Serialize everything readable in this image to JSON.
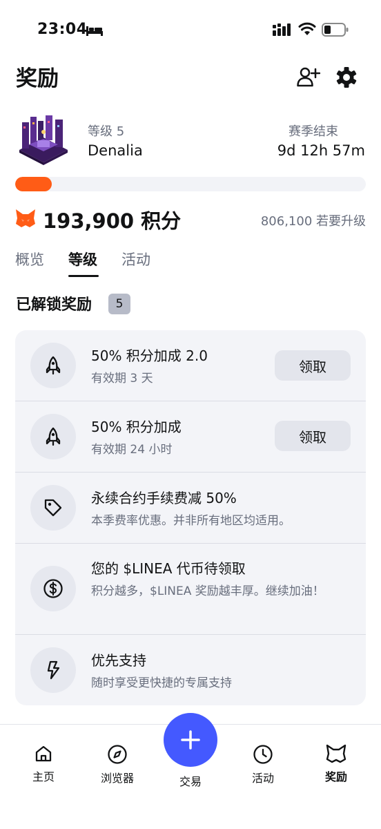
{
  "status_bar": {
    "time": "23:04"
  },
  "header": {
    "title": "奖励"
  },
  "season": {
    "level_label": "等级 5",
    "name": "Denalia",
    "end_label": "赛季结束",
    "countdown": "9d 12h 57m",
    "progress_fraction": 0.105
  },
  "points": {
    "value": "193,900 积分",
    "to_next_level": "806,100 若要升级"
  },
  "tabs": [
    {
      "label": "概览",
      "active": false
    },
    {
      "label": "等级",
      "active": true
    },
    {
      "label": "活动",
      "active": false
    }
  ],
  "unlocked": {
    "title": "已解锁奖励",
    "count": "5"
  },
  "rewards": [
    {
      "icon": "rocket-icon",
      "title": "50% 积分加成 2.0",
      "desc": "有效期 3 天",
      "button": "领取"
    },
    {
      "icon": "rocket-icon",
      "title": "50% 积分加成",
      "desc": "有效期 24 小时",
      "button": "领取"
    },
    {
      "icon": "tag-icon",
      "title": "永续合约手续费减 50%",
      "desc": "本季费率优惠。并非所有地区均适用。"
    },
    {
      "icon": "dollar-coin-icon",
      "title": "您的 $LINEA 代币待领取",
      "desc": "积分越多，$LINEA 奖励越丰厚。继续加油！"
    },
    {
      "icon": "lightning-icon",
      "title": "优先支持",
      "desc": "随时享受更快捷的专属支持"
    }
  ],
  "nav": {
    "items": [
      {
        "label": "主页",
        "icon": "home-icon"
      },
      {
        "label": "浏览器",
        "icon": "compass-icon"
      },
      {
        "label": "交易",
        "icon": "plus-icon"
      },
      {
        "label": "活动",
        "icon": "clock-icon"
      },
      {
        "label": "奖励",
        "icon": "fox-outline-icon"
      }
    ]
  },
  "colors": {
    "accent": "#ff5c16",
    "primary": "#4459ff",
    "card_bg": "#f3f4f8",
    "muted_text": "#686e7d"
  }
}
